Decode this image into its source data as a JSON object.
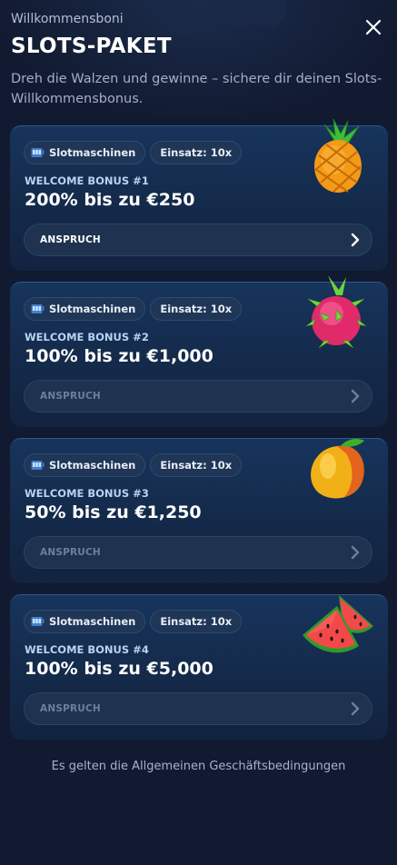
{
  "header": {
    "eyebrow": "Willkommensboni",
    "title": "SLOTS-PAKET",
    "subtitle": "Dreh die Walzen und gewinne – sichere dir deinen Slots-Willkommensbonus."
  },
  "cards": [
    {
      "tag_type": "Slotmaschinen",
      "tag_wager": "Einsatz: 10x",
      "bonus_label": "WELCOME BONUS #1",
      "bonus_amount": "200% bis zu €250",
      "claim_label": "ANSPRUCH",
      "claim_enabled": true,
      "fruit_icon": "pineapple-icon"
    },
    {
      "tag_type": "Slotmaschinen",
      "tag_wager": "Einsatz: 10x",
      "bonus_label": "WELCOME BONUS #2",
      "bonus_amount": "100% bis zu €1,000",
      "claim_label": "ANSPRUCH",
      "claim_enabled": false,
      "fruit_icon": "dragonfruit-icon"
    },
    {
      "tag_type": "Slotmaschinen",
      "tag_wager": "Einsatz: 10x",
      "bonus_label": "WELCOME BONUS #3",
      "bonus_amount": "50% bis zu €1,250",
      "claim_label": "ANSPRUCH",
      "claim_enabled": false,
      "fruit_icon": "mango-icon"
    },
    {
      "tag_type": "Slotmaschinen",
      "tag_wager": "Einsatz: 10x",
      "bonus_label": "WELCOME BONUS #4",
      "bonus_amount": "100% bis zu €5,000",
      "claim_label": "ANSPRUCH",
      "claim_enabled": false,
      "fruit_icon": "watermelon-icon"
    }
  ],
  "footer": {
    "terms": "Es gelten die Allgemeinen Geschäftsbedingungen"
  },
  "colors": {
    "background": "#111a30",
    "card": "#152d50",
    "card_border": "#2a5b96",
    "claim_bg": "#1f3250",
    "disabled_text": "#6f7f9a"
  }
}
